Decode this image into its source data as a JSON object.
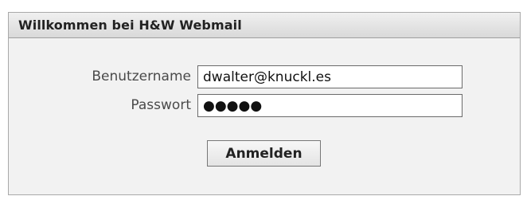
{
  "login": {
    "title": "Willkommen bei H&W Webmail",
    "username_label": "Benutzername",
    "username_value": "dwalter@knuckl.es",
    "password_label": "Passwort",
    "password_value": "●●●●●",
    "submit_label": "Anmelden"
  }
}
